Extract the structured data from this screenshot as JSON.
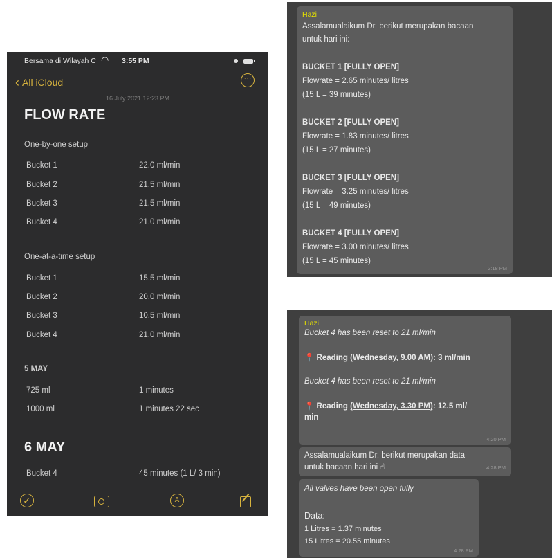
{
  "notes": {
    "status": {
      "carrier": "Bersama di Wilayah C",
      "time": "3:55 PM"
    },
    "nav": {
      "back_label": "All iCloud"
    },
    "note_date": "16 July 2021 12:23 PM",
    "title": "FLOW RATE",
    "sections": [
      {
        "heading": "One-by-one setup",
        "rows": [
          {
            "label": "Bucket 1",
            "value": "22.0 ml/min"
          },
          {
            "label": "Bucket 2",
            "value": "21.5 ml/min"
          },
          {
            "label": "Bucket 3",
            "value": "21.5 ml/min"
          },
          {
            "label": "Bucket 4",
            "value": "21.0 ml/min"
          }
        ]
      },
      {
        "heading": "One-at-a-time setup",
        "rows": [
          {
            "label": "Bucket 1",
            "value": "15.5 ml/min"
          },
          {
            "label": "Bucket 2",
            "value": "20.0 ml/min"
          },
          {
            "label": "Bucket 3",
            "value": "10.5 ml/min"
          },
          {
            "label": "Bucket 4",
            "value": "21.0 ml/min"
          }
        ]
      },
      {
        "heading": "5 MAY",
        "rows": [
          {
            "label": "725 ml",
            "value": "1 minutes"
          },
          {
            "label": "1000 ml",
            "value": "1 minutes 22 sec"
          }
        ]
      }
    ],
    "day6": {
      "heading": "6 MAY",
      "rows": [
        {
          "label": "Bucket 4",
          "value": "45 minutes (1 L/ 3 min)"
        }
      ]
    },
    "icons": [
      "checklist-icon",
      "camera-icon",
      "markup-pen-icon",
      "compose-icon"
    ]
  },
  "chat1": {
    "sender": "Hazi",
    "intro": [
      "Assalamualaikum Dr, berikut merupakan bacaan",
      "untuk hari ini:"
    ],
    "buckets": [
      {
        "title": "BUCKET 1 [FULLY OPEN]",
        "flow": "Flowrate = 2.65 minutes/ litres",
        "total": "(15 L = 39 minutes)"
      },
      {
        "title": "BUCKET 2 [FULLY OPEN]",
        "flow": "Flowrate = 1.83 minutes/ litres",
        "total": "(15 L = 27 minutes)"
      },
      {
        "title": "BUCKET 3 [FULLY OPEN]",
        "flow": "Flowrate = 3.25 minutes/ litres",
        "total": "(15 L = 49 minutes)"
      },
      {
        "title": "BUCKET 4 [FULLY OPEN]",
        "flow": "Flowrate = 3.00 minutes/ litres",
        "total": "(15 L = 45 minutes)"
      }
    ],
    "time": "2:18 PM"
  },
  "chat2": {
    "sender": "Hazi",
    "reset1": "Bucket 4 has been reset to 21 ml/min",
    "reading1_prefix": "Reading",
    "reading1_day": "(Wednesday, 9.00 AM)",
    "reading1_value": ": 3 ml/min",
    "reset2": "Bucket 4 has been reset to 21 ml/min",
    "reading2_prefix": "Reading",
    "reading2_day": "(Wednesday, 3.30 PM)",
    "reading2_value": ": 12.5 ml/",
    "reading2_cont": "min",
    "time1": "4:20 PM",
    "msg2": [
      "Assalamualaikum Dr, berikut merupakan data",
      "untuk bacaan hari ini"
    ],
    "time2": "4:28 PM",
    "msg3_italic": "All valves have been open fully",
    "data_label": "Data:",
    "data_lines": [
      "1 Litres = 1.37 minutes",
      "15 Litres = 20.55 minutes"
    ],
    "time3": "4:28 PM"
  },
  "colors": {
    "accent": "#d7b33e",
    "sender": "#e4e000",
    "bubble": "#5c5c5c"
  }
}
